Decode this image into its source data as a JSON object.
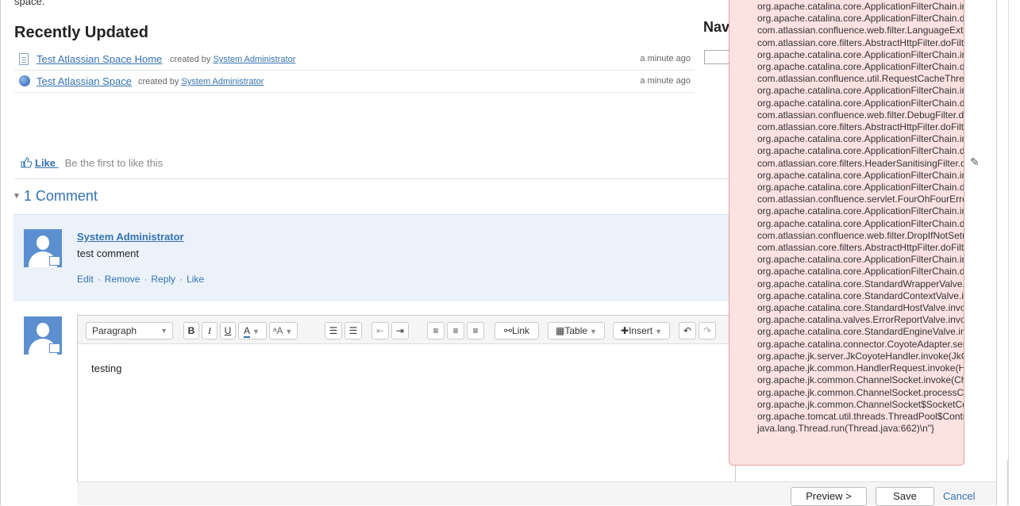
{
  "top_text": "space.",
  "recently_updated": {
    "heading": "Recently Updated",
    "items": [
      {
        "title": "Test Atlassian Space Home",
        "created_by_label": "created by",
        "author": "System Administrator",
        "time": "a minute ago",
        "icon": "page-icon"
      },
      {
        "title": "Test Atlassian Space",
        "created_by_label": "created by",
        "author": "System Administrator",
        "time": "a minute ago",
        "icon": "space-icon"
      }
    ]
  },
  "nav_heading": "Nav",
  "like": {
    "button": "Like",
    "text": "Be the first to like this"
  },
  "comments": {
    "heading": "1 Comment",
    "items": [
      {
        "author": "System Administrator",
        "body": "test comment",
        "actions": [
          "Edit",
          "Remove",
          "Reply",
          "Like"
        ]
      }
    ]
  },
  "editor": {
    "paragraph_select": "Paragraph",
    "bold": "B",
    "italic": "I",
    "underline": "U",
    "text_color": "A",
    "font_size": "ᵃA",
    "link": "Link",
    "table": "Table",
    "insert": "Insert",
    "content": "testing",
    "preview_button": "Preview >",
    "save_button": "Save",
    "cancel_link": "Cancel"
  },
  "error_popup": {
    "lines": [
      "org.apache.catalina.core.ApplicationFilterChain.interna",
      "org.apache.catalina.core.ApplicationFilterChain.doFilte",
      "com.atlassian.confluence.web.filter.LanguageExtractio",
      "com.atlassian.core.filters.AbstractHttpFilter.doFilter(A",
      "org.apache.catalina.core.ApplicationFilterChain.interna",
      "org.apache.catalina.core.ApplicationFilterChain.doFilte",
      "com.atlassian.confluence.util.RequestCacheThreadLo",
      "org.apache.catalina.core.ApplicationFilterChain.interna",
      "org.apache.catalina.core.ApplicationFilterChain.doFilte",
      "com.atlassian.confluence.web.filter.DebugFilter.doFilte",
      "com.atlassian.core.filters.AbstractHttpFilter.doFilter(A",
      "org.apache.catalina.core.ApplicationFilterChain.interna",
      "org.apache.catalina.core.ApplicationFilterChain.doFilte",
      "com.atlassian.core.filters.HeaderSanitisingFilter.doFilt",
      "org.apache.catalina.core.ApplicationFilterChain.interna",
      "org.apache.catalina.core.ApplicationFilterChain.doFilte",
      "com.atlassian.confluence.servlet.FourOhFourErrorLog",
      "org.apache.catalina.core.ApplicationFilterChain.interna",
      "org.apache.catalina.core.ApplicationFilterChain.doFilte",
      "com.atlassian.confluence.web.filter.DropIfNotSetupFil",
      "com.atlassian.core.filters.AbstractHttpFilter.doFilter(A",
      "org.apache.catalina.core.ApplicationFilterChain.interna",
      "org.apache.catalina.core.ApplicationFilterChain.doFilte",
      "org.apache.catalina.core.StandardWrapperValve.invok",
      "org.apache.catalina.core.StandardContextValve.invoke",
      "org.apache.catalina.core.StandardHostValve.invoke(S",
      "org.apache.catalina.valves.ErrorReportValve.invoke(E",
      "org.apache.catalina.core.StandardEngineValve.invoke",
      "org.apache.catalina.connector.CoyoteAdapter.service(",
      "org.apache.jk.server.JkCoyoteHandler.invoke(JkCoyo",
      "org.apache.jk.common.HandlerRequest.invoke(Handle",
      "org.apache.jk.common.ChannelSocket.invoke(Channe",
      "org.apache.jk.common.ChannelSocket.processConne",
      "org.apache.jk.common.ChannelSocket$SocketConne",
      "org.apache.tomcat.util.threads.ThreadPool$ControlRu",
      "java.lang.Thread.run(Thread.java:662)\\n\"}"
    ]
  },
  "colors": {
    "link": "#3572b0",
    "error_bg": "#fde2e2",
    "comment_bg": "#ebf2f9"
  }
}
